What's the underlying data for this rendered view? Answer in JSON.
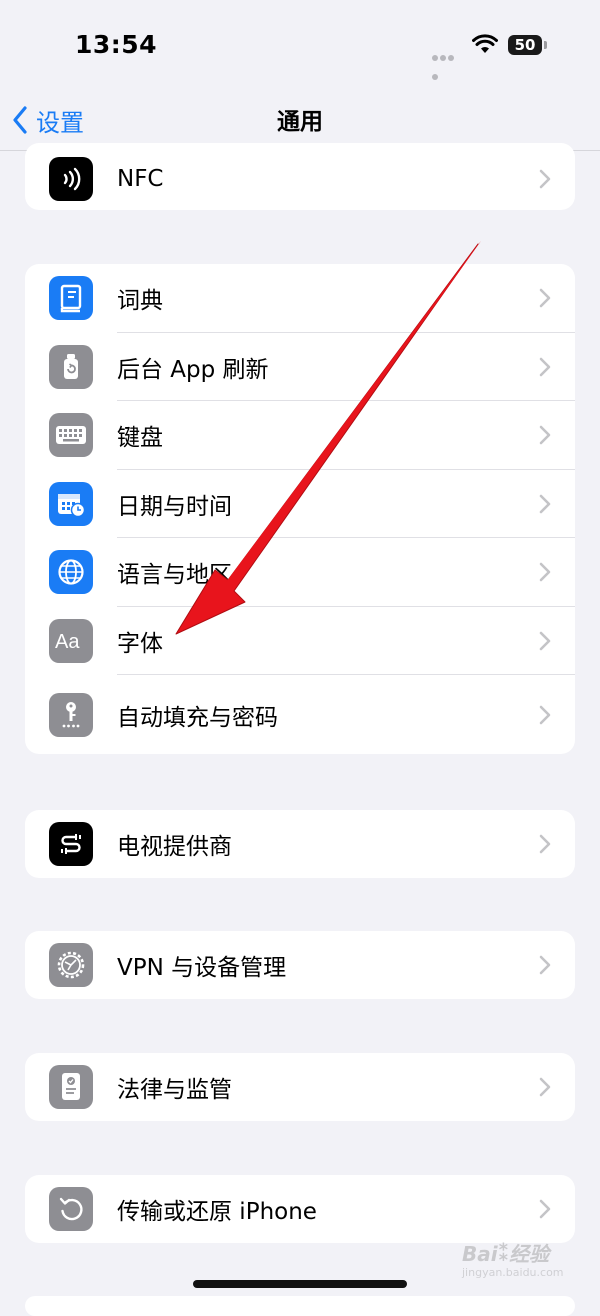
{
  "status_bar": {
    "time": "13:54",
    "battery": "50"
  },
  "nav": {
    "back_label": "设置",
    "title": "通用"
  },
  "groups": [
    {
      "rows": [
        {
          "label": "NFC",
          "icon": "nfc-icon"
        }
      ]
    },
    {
      "rows": [
        {
          "label": "词典",
          "icon": "dictionary-icon"
        },
        {
          "label": "后台 App 刷新",
          "icon": "background-refresh-icon"
        },
        {
          "label": "键盘",
          "icon": "keyboard-icon"
        },
        {
          "label": "日期与时间",
          "icon": "calendar-clock-icon"
        },
        {
          "label": "语言与地区",
          "icon": "globe-icon"
        },
        {
          "label": "字体",
          "icon": "font-icon"
        },
        {
          "label": "自动填充与密码",
          "icon": "key-icon"
        }
      ]
    },
    {
      "rows": [
        {
          "label": "电视提供商",
          "icon": "tv-provider-icon"
        }
      ]
    },
    {
      "rows": [
        {
          "label": "VPN 与设备管理",
          "icon": "gear-icon"
        }
      ]
    },
    {
      "rows": [
        {
          "label": "法律与监管",
          "icon": "certificate-icon"
        }
      ]
    },
    {
      "rows": [
        {
          "label": "传输或还原 iPhone",
          "icon": "reset-icon"
        }
      ]
    }
  ],
  "annotation": {
    "arrow_color": "#e8141c"
  },
  "colors": {
    "accent": "#1a7cf5",
    "blue_icon": "#1a7cf5",
    "gray_icon": "#8e8e93",
    "black_icon": "#000000"
  },
  "watermark": {
    "text": "Bai 经验",
    "sub": "jingyan.baidu.com"
  }
}
